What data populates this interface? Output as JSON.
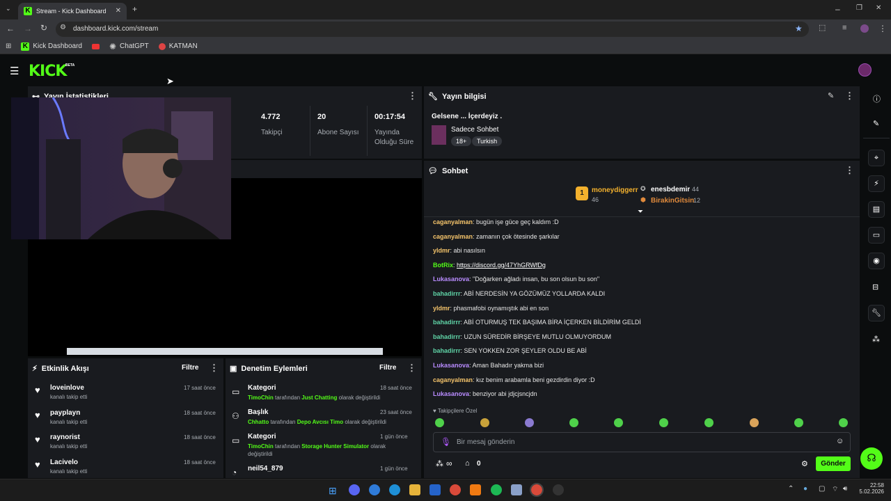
{
  "browser": {
    "tab_title": "Stream - Kick Dashboard",
    "url": "dashboard.kick.com/stream",
    "bookmarks": [
      "Kick Dashboard",
      "ChatGPT",
      "KATMAN"
    ]
  },
  "header": {
    "logo": "KICK",
    "logo_badge": "BETA"
  },
  "stats": {
    "title": "Yayın İstatistikleri",
    "items": [
      {
        "value": "4.772",
        "label": "Takipçi"
      },
      {
        "value": "20",
        "label": "Abone Sayısı"
      },
      {
        "value": "00:17:54",
        "label": "Yayında Olduğu Süre"
      }
    ]
  },
  "stream_info": {
    "title": "Yayın bilgisi",
    "stream_title": "Gelsene ... İçerdeyiz .",
    "category": "Sadece Sohbet",
    "tags": [
      "18+",
      "Turkish"
    ]
  },
  "chat": {
    "title": "Sohbet",
    "leaderboard": [
      {
        "rank": "1",
        "name": "moneydiggerr",
        "count": "46"
      },
      {
        "name": "enesbdemir",
        "count": "44"
      },
      {
        "name": "BirakinGitsin",
        "count": "12"
      }
    ],
    "messages": [
      {
        "user": "caganyalman",
        "color": "#f5c46b",
        "text": "bugün işe güce geç kaldım :D"
      },
      {
        "user": "caganyalman",
        "color": "#f5c46b",
        "text": "zamanın çok ötesinde şarkılar"
      },
      {
        "user": "yldmr",
        "color": "#f5c46b",
        "text": "abi nasılsın"
      },
      {
        "user": "BotRix",
        "color": "#53fc18",
        "text": "https://discord.gg/47YhGRWfDg"
      },
      {
        "user": "Lukasanova",
        "color": "#b98cff",
        "text": "\"Doğarken ağladı insan, bu son olsun bu son\""
      },
      {
        "user": "bahadirrr",
        "color": "#5fd3a6",
        "text": "ABİ NERDESİN YA GÖZÜMÜZ YOLLARDA KALDI"
      },
      {
        "user": "yldmr",
        "color": "#f5c46b",
        "text": "phasmafobi oynamıştık abi en son"
      },
      {
        "user": "bahadirrr",
        "color": "#5fd3a6",
        "text": "ABİ OTURMUŞ TEK BAŞIMA BİRA İÇERKEN BİLDİRİM GELDİ"
      },
      {
        "user": "bahadirrr",
        "color": "#5fd3a6",
        "text": "UZUN SÜREDİR BİRŞEYE MUTLU OLMUYORDUM"
      },
      {
        "user": "bahadirrr",
        "color": "#5fd3a6",
        "text": "SEN YOKKEN ZOR ŞEYLER OLDU BE ABİ"
      },
      {
        "user": "Lukasanova",
        "color": "#b98cff",
        "text": "Aman Bahadır yakma bizi"
      },
      {
        "user": "caganyalman",
        "color": "#f5c46b",
        "text": "kız benim arabamla beni gezdirdin diyor :D"
      },
      {
        "user": "Lukasanova",
        "color": "#b98cff",
        "text": "benziyor abi jdjcjsncjdn"
      }
    ],
    "followers_label": "Takipçilere Özel",
    "input_placeholder": "Bir mesaj gönderin",
    "points": "∞",
    "store_count": "0",
    "send_label": "Gönder"
  },
  "activity": {
    "title": "Etkinlik Akışı",
    "filter_label": "Filtre",
    "items": [
      {
        "name": "loveinlove",
        "sub": "kanalı takip etti",
        "time": "17 saat önce"
      },
      {
        "name": "payplayn",
        "sub": "kanalı takip etti",
        "time": "18 saat önce"
      },
      {
        "name": "raynorist",
        "sub": "kanalı takip etti",
        "time": "18 saat önce"
      },
      {
        "name": "Lacivelo",
        "sub": "kanalı takip etti",
        "time": "18 saat önce"
      }
    ]
  },
  "moderation": {
    "title": "Denetim Eylemleri",
    "filter_label": "Filtre",
    "items": [
      {
        "kind": "Kategori",
        "actor": "TimoChin",
        "mid": "tarafından",
        "value": "Just Chatting",
        "tail": "olarak değiştirildi",
        "time": "18 saat önce"
      },
      {
        "kind": "Başlık",
        "actor": "Chhatto",
        "mid": "tarafından",
        "value": "Depo Avcısı Timo",
        "tail": "olarak değiştirildi",
        "time": "23 saat önce"
      },
      {
        "kind": "Kategori",
        "actor": "TimoChin",
        "mid": "tarafından",
        "value": "Storage Hunter Simulator",
        "tail": "olarak değiştirildi",
        "time": "1 gün önce"
      },
      {
        "kind": "neil54_879",
        "time": "1 gün önce"
      }
    ]
  },
  "taskbar": {
    "time": "22:58",
    "date": "5.02.2026"
  },
  "colors": {
    "accent": "#53fc18",
    "panel": "#191b1f",
    "bg": "#0b0d0e"
  }
}
